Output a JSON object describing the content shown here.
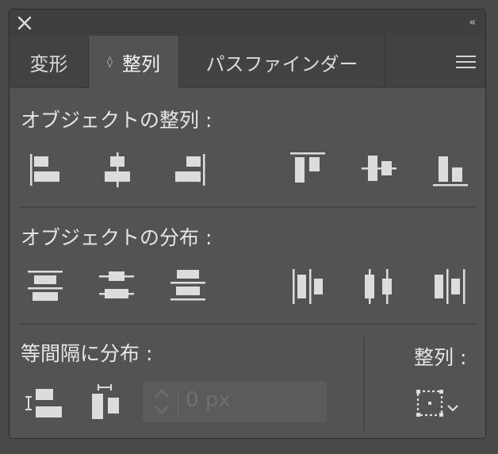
{
  "tabs": [
    {
      "label": "変形",
      "active": false
    },
    {
      "label": "整列",
      "active": true
    },
    {
      "label": "パスファインダー",
      "active": false
    }
  ],
  "active_tab_indicator": "◊",
  "sections": {
    "align_objects": "オブジェクトの整列 :",
    "distribute_objects": "オブジェクトの分布 :",
    "distribute_spacing": "等間隔に分布 :",
    "align_to": "整列 :"
  },
  "spacing_input": {
    "value": "0 px",
    "disabled": true
  },
  "collapse_glyph": "‹‹"
}
